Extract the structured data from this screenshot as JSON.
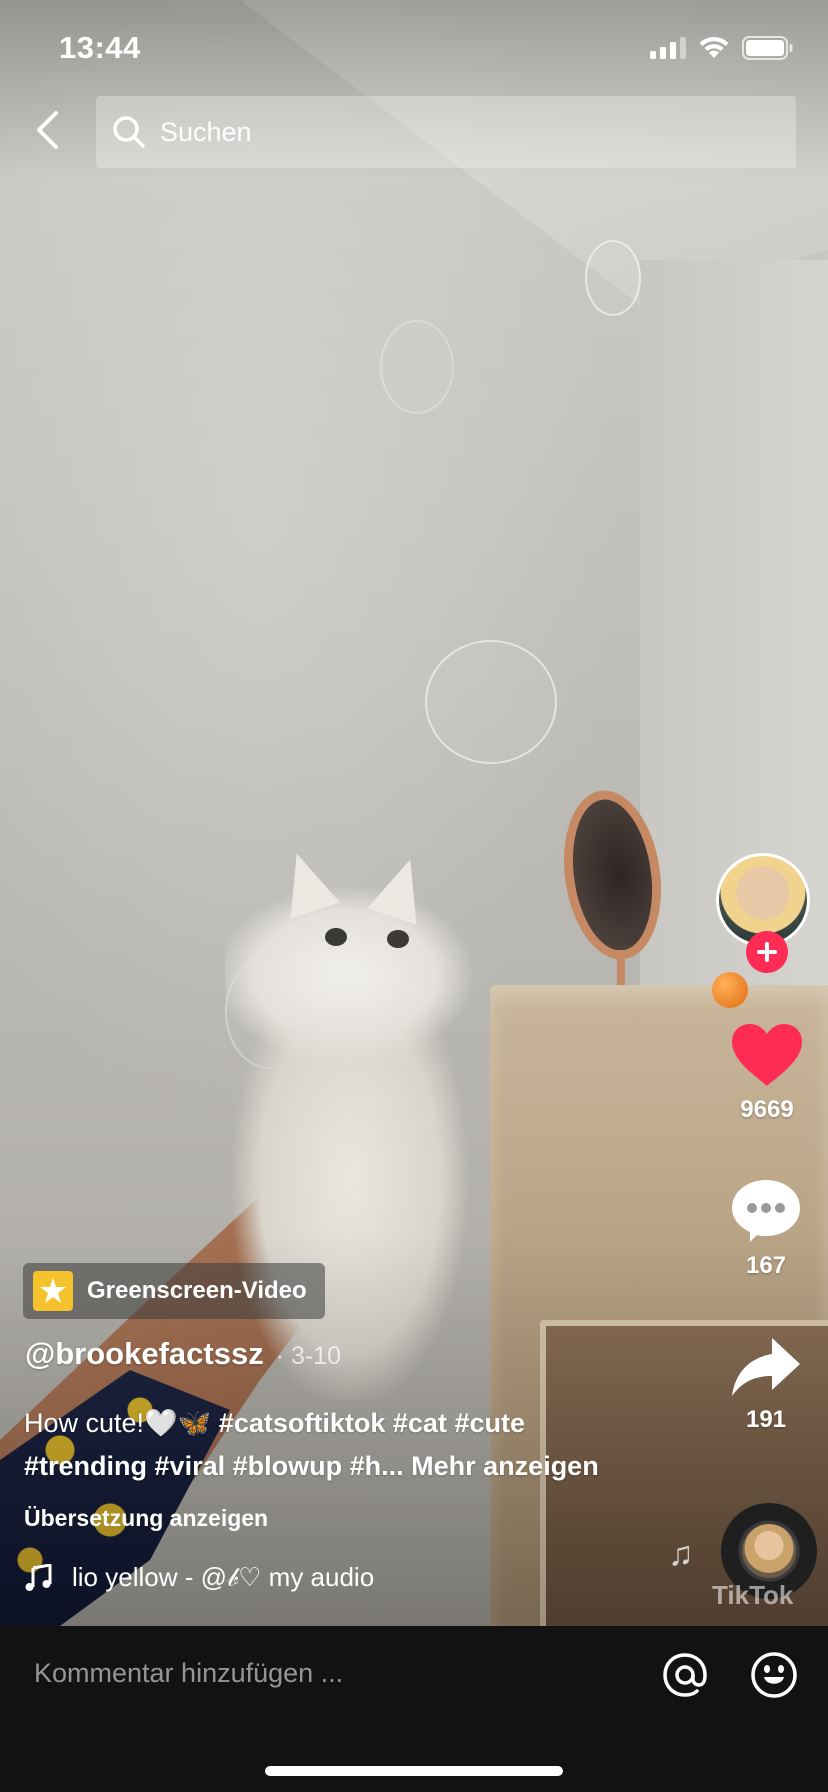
{
  "status_bar": {
    "time": "13:44"
  },
  "header": {
    "search_placeholder": "Suchen"
  },
  "video": {
    "effect_label": "Greenscreen-Video",
    "username": "@brookefactssz",
    "date": "· 3-10",
    "caption": {
      "text": "How cute!🤍🦋 ",
      "hashtags": [
        "#catsoftiktok",
        "#cat",
        "#cute",
        "#trending",
        "#viral",
        "#blowup",
        "#h..."
      ],
      "more_label": "Mehr anzeigen"
    },
    "translate_label": "Übersetzung anzeigen",
    "music_text": "lio yellow - @𝒷♡     my audio",
    "watermark": "TikTok"
  },
  "rail": {
    "likes": "9669",
    "comments": "167",
    "shares": "191",
    "like_color": "#fe2c55"
  },
  "comment_bar": {
    "placeholder": "Kommentar hinzufügen ..."
  }
}
